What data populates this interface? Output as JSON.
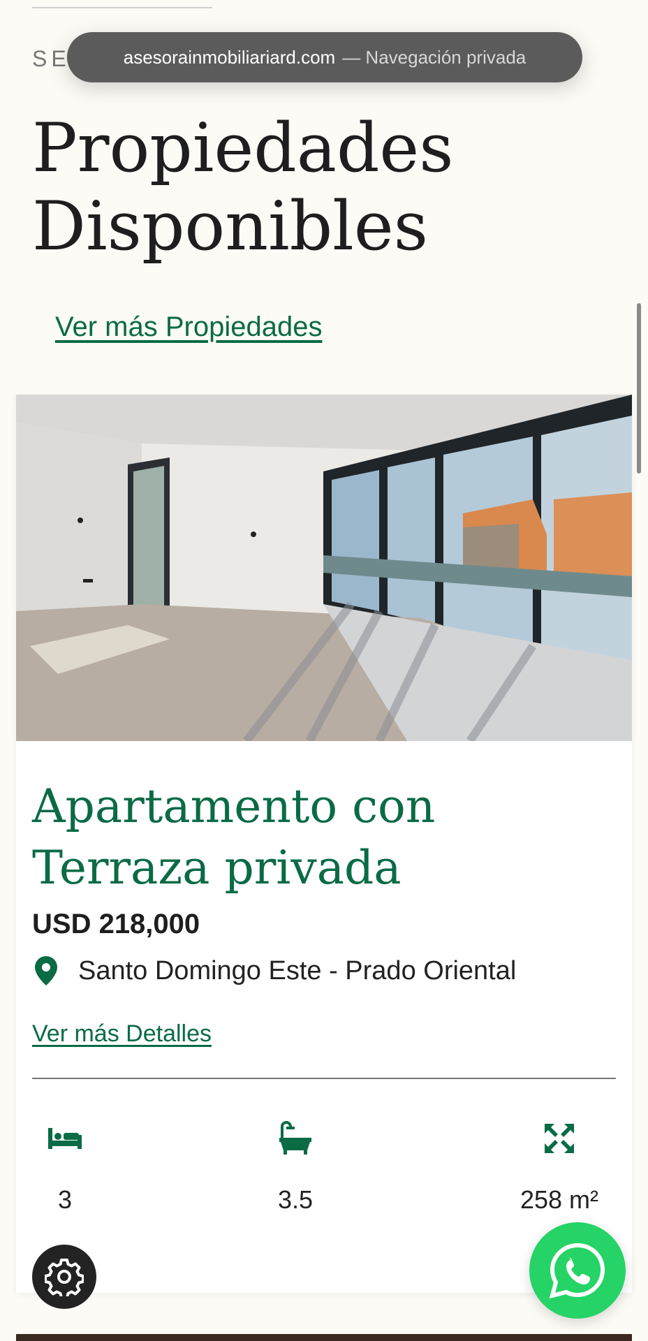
{
  "browser": {
    "domain": "asesorainmobiliariard.com",
    "mode": "— Navegación privada"
  },
  "section": {
    "label": "SE",
    "title_line1": "Propiedades",
    "title_line2": "Disponibles",
    "more_link": "Ver más Propiedades"
  },
  "listing": {
    "title": "Apartamento con Terraza privada",
    "price": "USD 218,000",
    "location": "Santo Domingo Este - Prado Oriental",
    "details_link": "Ver más Detalles",
    "features": {
      "bedrooms": "3",
      "bathrooms": "3.5",
      "area": "258 m²"
    }
  },
  "icons": {
    "location": "map-pin-icon",
    "bedrooms": "bed-icon",
    "bathrooms": "bathtub-icon",
    "area": "expand-arrows-icon",
    "settings": "gear-icon",
    "whatsapp": "whatsapp-icon"
  },
  "colors": {
    "brand_green": "#0a6b45",
    "whatsapp_green": "#25d366",
    "background": "#fdfbf6"
  }
}
